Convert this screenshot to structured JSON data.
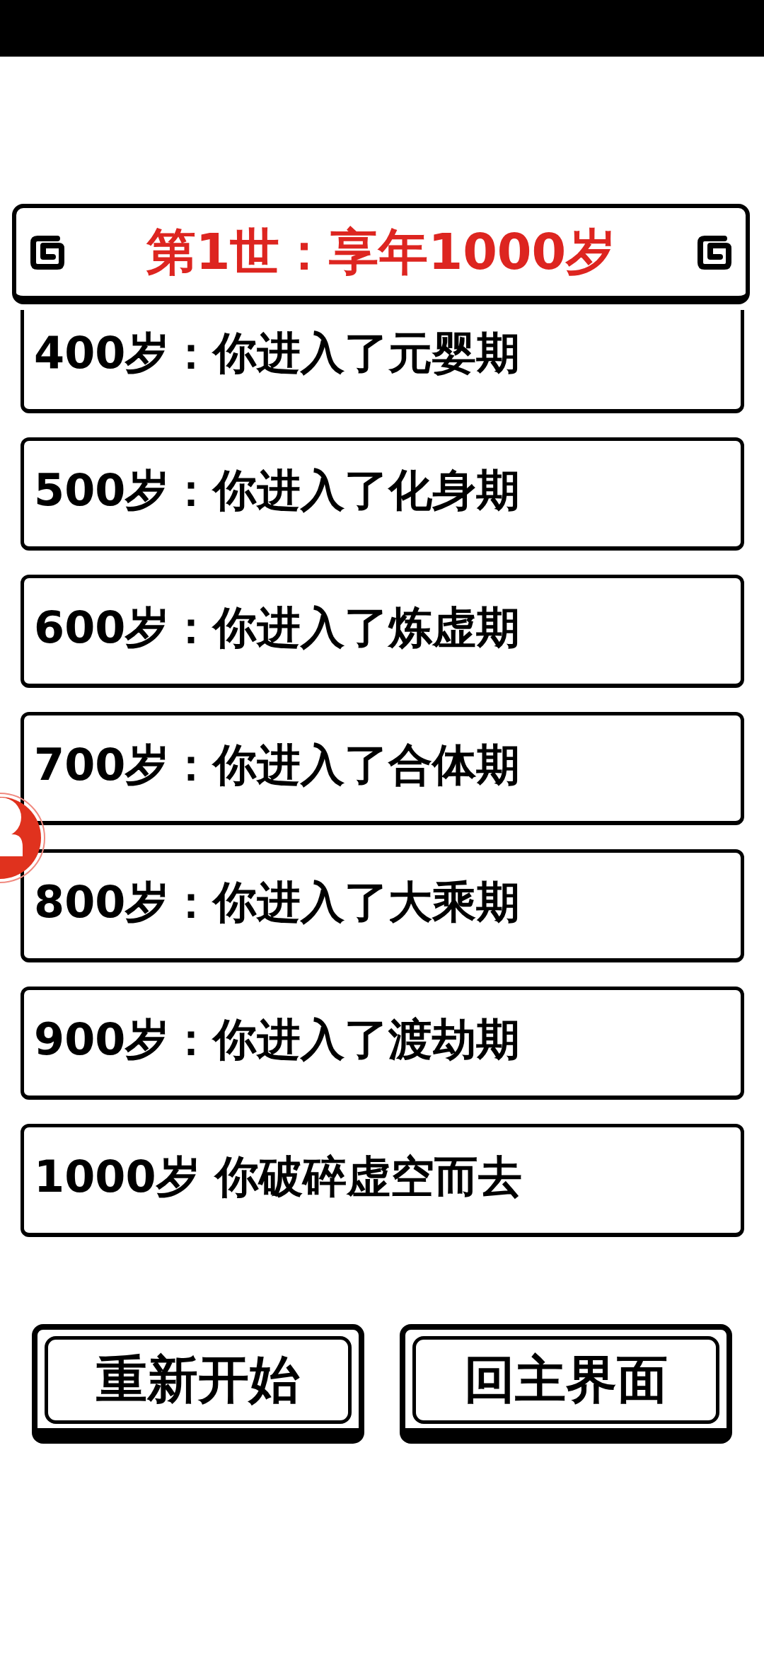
{
  "title": {
    "text": "第1世：享年1000岁"
  },
  "events": [
    {
      "text": "400岁：你进入了元婴期"
    },
    {
      "text": "500岁：你进入了化身期"
    },
    {
      "text": "600岁：你进入了炼虚期"
    },
    {
      "text": "700岁：你进入了合体期"
    },
    {
      "text": "800岁：你进入了大乘期"
    },
    {
      "text": "900岁：你进入了渡劫期"
    },
    {
      "text": "1000岁 你破碎虚空而去"
    }
  ],
  "buttons": [
    {
      "label": "重新开始"
    },
    {
      "label": "回主界面"
    }
  ]
}
